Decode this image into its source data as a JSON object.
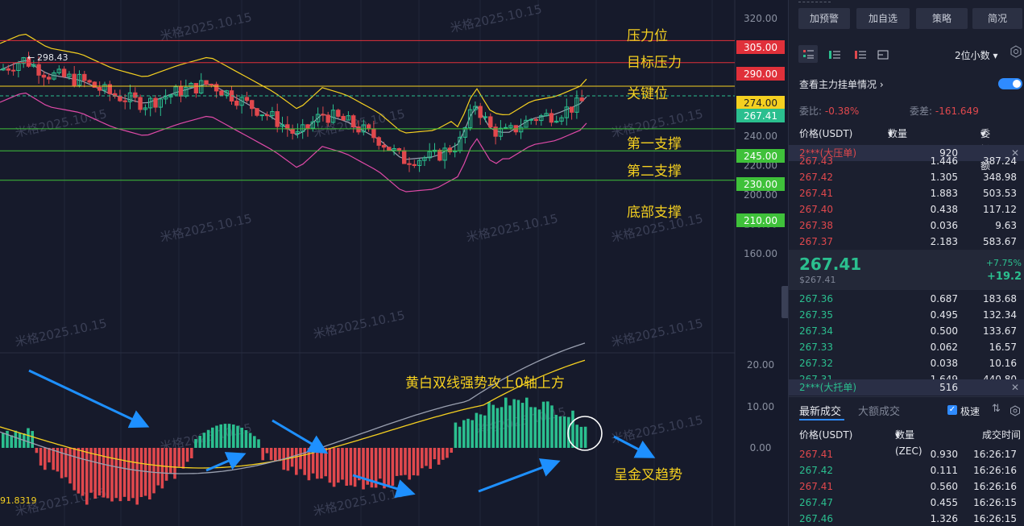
{
  "chart": {
    "price_ticks": [
      "320.00",
      "300.00",
      "280.00",
      "260.00",
      "240.00",
      "220.00",
      "200.00",
      "180.00",
      "160.00"
    ],
    "indicator_ticks": [
      "20.00",
      "10.00",
      "0.00"
    ],
    "levels": [
      {
        "label": "305.00",
        "name": "压力位",
        "color": "#e0303a"
      },
      {
        "label": "290.00",
        "name": "目标压力",
        "color": "#e0303a"
      },
      {
        "label": "274.00",
        "name": "关键位",
        "color": "#f5d020"
      },
      {
        "label": "245.00",
        "name": "第一支撑",
        "color": "#3fc13a"
      },
      {
        "label": "230.00",
        "name": "第二支撑",
        "color": "#3fc13a"
      },
      {
        "label": "210.00",
        "name": "底部支撑",
        "color": "#3fc13a"
      }
    ],
    "current_price": "267.41",
    "high_marker": "298.43",
    "annotation_top": "黄白双线强势攻上0轴上方",
    "annotation_bottom": "呈金叉趋势",
    "indicator_value": "91.8319",
    "watermark": "米格2025.10.15"
  },
  "side": {
    "buttons": [
      "加预警",
      "加自选",
      "策略",
      "简况"
    ],
    "decimal_select": "2位小数",
    "link_text": "查看主力挂单情况",
    "ratio_label": "委比:",
    "ratio_value": "-0.38%",
    "diff_label": "委差:",
    "diff_value": "-161.649",
    "headers": {
      "price": "价格(USDT)",
      "qty": "数量 (ZEC)",
      "amount": "委托额"
    },
    "big_sell": {
      "label": "2***(大压单)",
      "value": "920"
    },
    "asks": [
      {
        "price": "267.43",
        "qty": "1.446",
        "amt": "387.24"
      },
      {
        "price": "267.42",
        "qty": "1.305",
        "amt": "348.98"
      },
      {
        "price": "267.41",
        "qty": "1.883",
        "amt": "503.53"
      },
      {
        "price": "267.40",
        "qty": "0.438",
        "amt": "117.12"
      },
      {
        "price": "267.38",
        "qty": "0.036",
        "amt": "9.63"
      },
      {
        "price": "267.37",
        "qty": "2.183",
        "amt": "583.67"
      }
    ],
    "last_price": "267.41",
    "last_price_sub": "$267.41",
    "change_pct": "+7.75%",
    "change_abs": "+19.2",
    "bids": [
      {
        "price": "267.36",
        "qty": "0.687",
        "amt": "183.68"
      },
      {
        "price": "267.35",
        "qty": "0.495",
        "amt": "132.34"
      },
      {
        "price": "267.34",
        "qty": "0.500",
        "amt": "133.67"
      },
      {
        "price": "267.33",
        "qty": "0.062",
        "amt": "16.57"
      },
      {
        "price": "267.32",
        "qty": "0.038",
        "amt": "10.16"
      },
      {
        "price": "267.31",
        "qty": "1.649",
        "amt": "440.80"
      }
    ],
    "big_buy": {
      "label": "2***(大托单)",
      "value": "516"
    },
    "trade_tabs": [
      "最新成交",
      "大额成交"
    ],
    "fast_label": "极速",
    "trade_headers": {
      "price": "价格(USDT)",
      "qty": "数量(ZEC)",
      "time": "成交时间"
    },
    "trades": [
      {
        "price": "267.41",
        "qty": "0.930",
        "time": "16:26:17",
        "side": "sell"
      },
      {
        "price": "267.42",
        "qty": "0.111",
        "time": "16:26:16",
        "side": "buy"
      },
      {
        "price": "267.41",
        "qty": "0.560",
        "time": "16:26:16",
        "side": "sell"
      },
      {
        "price": "267.47",
        "qty": "0.455",
        "time": "16:26:15",
        "side": "buy"
      },
      {
        "price": "267.46",
        "qty": "1.326",
        "time": "16:26:15",
        "side": "buy"
      }
    ]
  }
}
